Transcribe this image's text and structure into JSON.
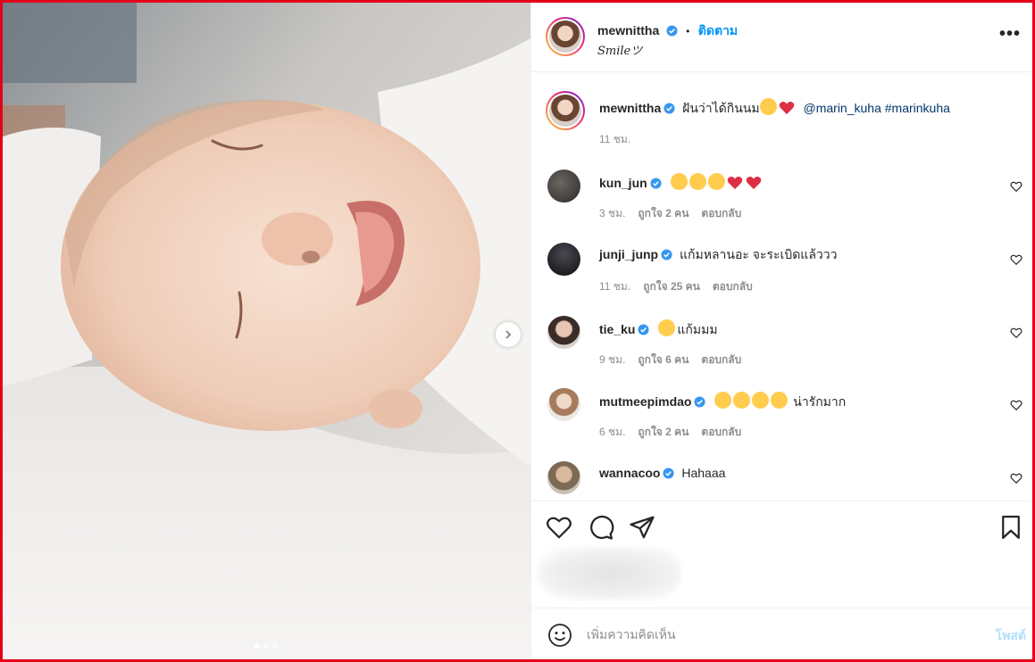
{
  "post": {
    "username": "mewnittha",
    "follow_label": "ติดตาม",
    "separator": "•",
    "subtitle": "Smileツ",
    "media_dots": 3,
    "active_dot": 1
  },
  "caption": {
    "username": "mewnittha",
    "text": "ฝันว่าได้กินนม",
    "mention": "@marin_kuha",
    "hashtag": "#marinkuha",
    "time": "11 ชม."
  },
  "comments": [
    {
      "username": "kun_jun",
      "text": "",
      "emojis": [
        "laugh",
        "laugh",
        "laugh",
        "heart",
        "heart"
      ],
      "time": "3 ชม.",
      "likes": "ถูกใจ 2 คน",
      "reply": "ตอบกลับ"
    },
    {
      "username": "junji_junp",
      "text": "แก้มหลานอะ จะระเบิดแล้ววว",
      "emojis": [],
      "time": "11 ชม.",
      "likes": "ถูกใจ 25 คน",
      "reply": "ตอบกลับ"
    },
    {
      "username": "tie_ku",
      "text": "แก้มมม",
      "emojis": [
        "star"
      ],
      "time": "9 ชม.",
      "likes": "ถูกใจ 6 คน",
      "reply": "ตอบกลับ"
    },
    {
      "username": "mutmeepimdao",
      "text": "น่ารักมาก",
      "emojis": [
        "star",
        "star",
        "star",
        "star"
      ],
      "time": "6 ชม.",
      "likes": "ถูกใจ 2 คน",
      "reply": "ตอบกลับ"
    },
    {
      "username": "wannacoo",
      "text": "Hahaaa",
      "emojis": [],
      "time": "",
      "likes": "",
      "reply": ""
    }
  ],
  "composer": {
    "placeholder": "เพิ่มความคิดเห็น",
    "post_label": "โพสต์"
  },
  "colors": {
    "link_blue": "#0095f6",
    "verified_blue": "#3897f0",
    "border_red": "#e4001b",
    "muted": "#8e8e8e"
  }
}
